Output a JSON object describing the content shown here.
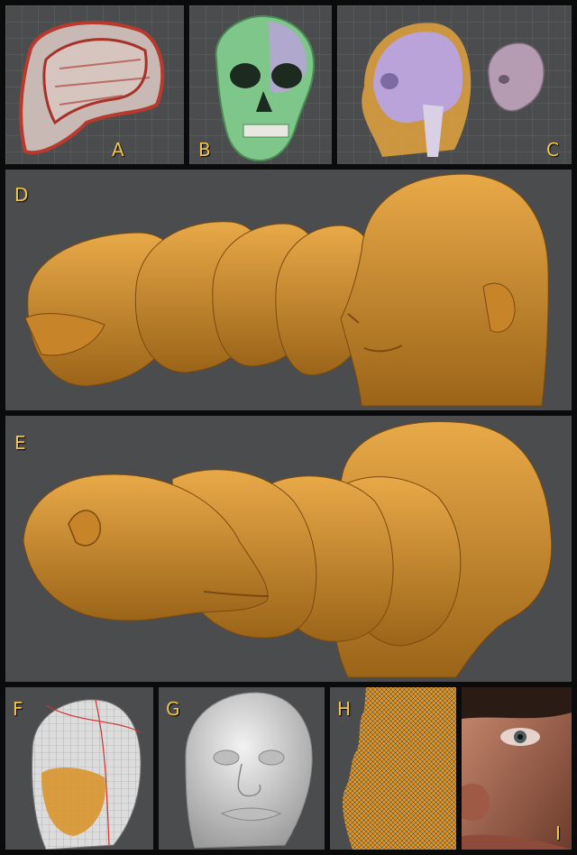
{
  "panel_labels": {
    "a": "A",
    "b": "B",
    "c": "C",
    "d": "D",
    "e": "E",
    "f": "F",
    "g": "G",
    "h": "H",
    "i": "I"
  },
  "colors": {
    "panel_background": "#4b4c4d",
    "frame": "#0b0b0b",
    "label": "#f2c64a",
    "bronze": "#d8952e",
    "skull_red": "#b83a2e",
    "skull_green": "#7fc68a",
    "skull_lavender": "#b9a3d8",
    "clay": "#d9d9d9"
  },
  "icons": {
    "a": "skull-ct-scan-icon",
    "b": "skull-frontal-icon",
    "c": "head-skull-overlay-icon",
    "d": "head-profile-sequence-icon",
    "e": "head-profile-sequence-icon",
    "f": "head-wireframe-icon",
    "g": "clay-head-sculpt-icon",
    "h": "mesh-profile-icon",
    "i": "textured-face-icon"
  }
}
